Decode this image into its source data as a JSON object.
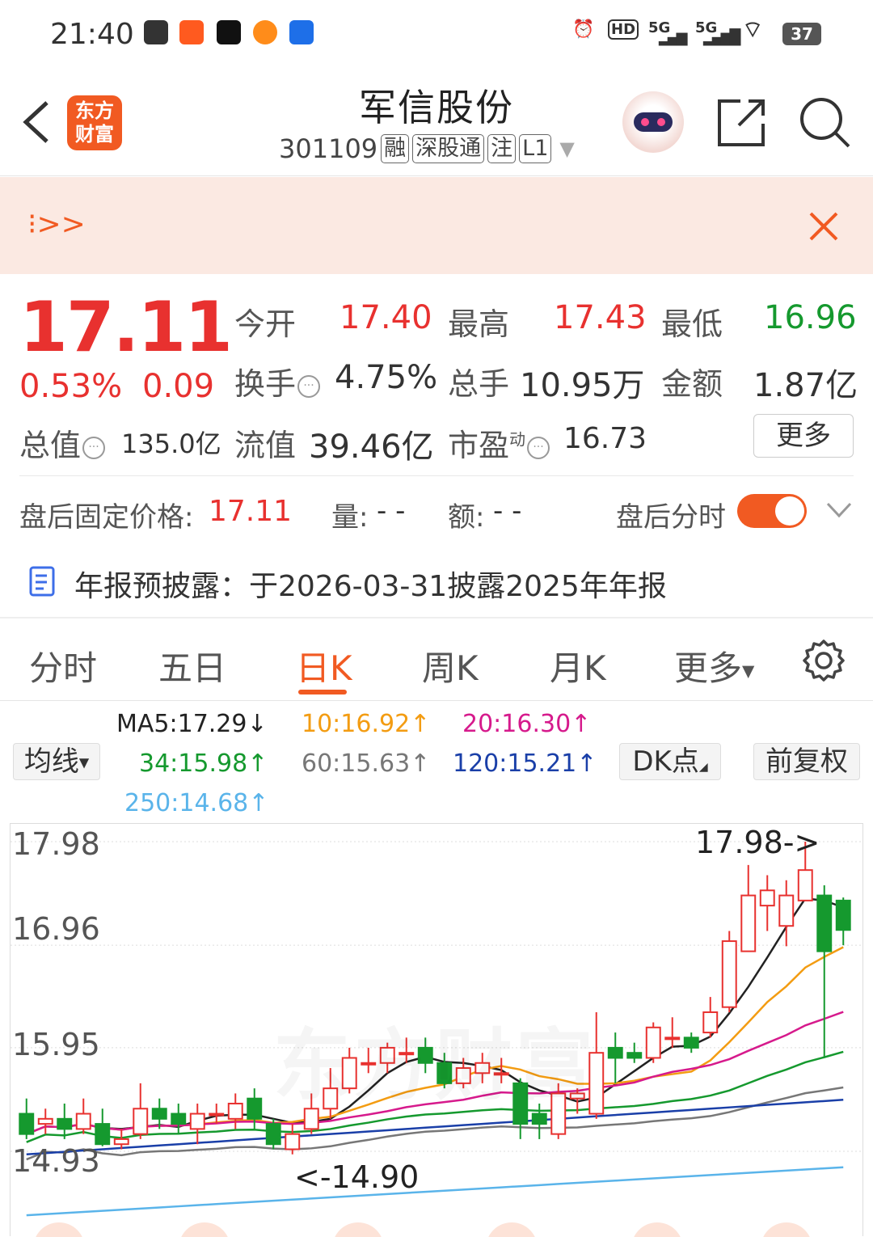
{
  "status": {
    "time": "21:40",
    "hd": "HD",
    "net1": "5G",
    "net2": "5G",
    "battery": "37"
  },
  "header": {
    "title": "军信股份",
    "code": "301109",
    "tags": [
      "融",
      "深股通",
      "注",
      "L1"
    ],
    "logo_line1": "东方",
    "logo_line2": "财富"
  },
  "banner": {
    "marquee": "⁝>>"
  },
  "quote": {
    "price": "17.11",
    "change_pct": "0.53%",
    "change": "0.09",
    "open_label": "今开",
    "open": "17.40",
    "high_label": "最高",
    "high": "17.43",
    "low_label": "最低",
    "low": "16.96",
    "turnover_label": "换手",
    "turnover": "4.75%",
    "volume_label": "总手",
    "volume": "10.95万",
    "amount_label": "金额",
    "amount": "1.87亿",
    "mktcap_label": "总值",
    "mktcap": "135.0亿",
    "float_label": "流值",
    "float": "39.46亿",
    "pe_label": "市盈",
    "pe_super": "动",
    "pe": "16.73",
    "more": "更多"
  },
  "afterhours": {
    "label": "盘后固定价格:",
    "price": "17.11",
    "vol_label": "量:",
    "vol": "- -",
    "amt_label": "额:",
    "amt": "- -",
    "toggle_label": "盘后分时"
  },
  "notice": "年报预披露：于2026-03-31披露2025年年报",
  "tabs": [
    "分时",
    "五日",
    "日K",
    "周K",
    "月K",
    "更多"
  ],
  "ma": {
    "selector": "均线",
    "ma5": "MA5:17.29↓",
    "ma10": "10:16.92↑",
    "ma20": "20:16.30↑",
    "ma34": "34:15.98↑",
    "ma60": "60:15.63↑",
    "ma120": "120:15.21↑",
    "ma250": "250:14.68↑",
    "dk": "DK点",
    "adjust": "前复权"
  },
  "colors": {
    "up": "#e8312f",
    "down": "#15992e",
    "accent": "#f15a22",
    "ma5": "#222222",
    "ma10": "#f39c12",
    "ma20": "#d61a8c",
    "ma34": "#15992e",
    "ma60": "#777777",
    "ma120": "#1a3fa8",
    "ma250": "#5ab4ea"
  },
  "chart_data": {
    "type": "candlestick",
    "y_ticks": [
      "17.98",
      "16.96",
      "15.95",
      "14.93"
    ],
    "max_label": "17.98->",
    "min_label": "<-14.90",
    "watermark": "东方财富",
    "candles": [
      {
        "o": 15.3,
        "c": 15.1,
        "h": 15.45,
        "l": 15.05
      },
      {
        "o": 15.2,
        "c": 15.25,
        "h": 15.35,
        "l": 15.1
      },
      {
        "o": 15.25,
        "c": 15.15,
        "h": 15.4,
        "l": 15.05
      },
      {
        "o": 15.15,
        "c": 15.3,
        "h": 15.45,
        "l": 15.1
      },
      {
        "o": 15.2,
        "c": 15.0,
        "h": 15.35,
        "l": 14.98
      },
      {
        "o": 15.0,
        "c": 15.05,
        "h": 15.15,
        "l": 14.95
      },
      {
        "o": 15.1,
        "c": 15.35,
        "h": 15.6,
        "l": 15.05
      },
      {
        "o": 15.35,
        "c": 15.25,
        "h": 15.45,
        "l": 15.15
      },
      {
        "o": 15.3,
        "c": 15.2,
        "h": 15.4,
        "l": 15.1
      },
      {
        "o": 15.15,
        "c": 15.3,
        "h": 15.4,
        "l": 15.0
      },
      {
        "o": 15.3,
        "c": 15.3,
        "h": 15.4,
        "l": 15.2
      },
      {
        "o": 15.25,
        "c": 15.4,
        "h": 15.5,
        "l": 15.15
      },
      {
        "o": 15.45,
        "c": 15.25,
        "h": 15.55,
        "l": 15.15
      },
      {
        "o": 15.2,
        "c": 15.0,
        "h": 15.25,
        "l": 14.95
      },
      {
        "o": 14.95,
        "c": 15.1,
        "h": 15.2,
        "l": 14.9
      },
      {
        "o": 15.15,
        "c": 15.35,
        "h": 15.5,
        "l": 15.1
      },
      {
        "o": 15.35,
        "c": 15.55,
        "h": 15.75,
        "l": 15.25
      },
      {
        "o": 15.55,
        "c": 15.85,
        "h": 15.95,
        "l": 15.5
      },
      {
        "o": 15.8,
        "c": 15.8,
        "h": 15.95,
        "l": 15.7
      },
      {
        "o": 15.8,
        "c": 15.95,
        "h": 16.0,
        "l": 15.7
      },
      {
        "o": 15.9,
        "c": 15.9,
        "h": 16.05,
        "l": 15.8
      },
      {
        "o": 15.95,
        "c": 15.8,
        "h": 16.05,
        "l": 15.7
      },
      {
        "o": 15.8,
        "c": 15.6,
        "h": 15.9,
        "l": 15.55
      },
      {
        "o": 15.6,
        "c": 15.75,
        "h": 15.85,
        "l": 15.55
      },
      {
        "o": 15.7,
        "c": 15.8,
        "h": 15.9,
        "l": 15.6
      },
      {
        "o": 15.7,
        "c": 15.7,
        "h": 15.85,
        "l": 15.6
      },
      {
        "o": 15.6,
        "c": 15.2,
        "h": 15.65,
        "l": 15.05
      },
      {
        "o": 15.3,
        "c": 15.2,
        "h": 15.4,
        "l": 15.05
      },
      {
        "o": 15.1,
        "c": 15.5,
        "h": 15.6,
        "l": 15.05
      },
      {
        "o": 15.45,
        "c": 15.5,
        "h": 15.55,
        "l": 15.3
      },
      {
        "o": 15.3,
        "c": 15.9,
        "h": 16.3,
        "l": 15.25
      },
      {
        "o": 15.95,
        "c": 15.85,
        "h": 16.1,
        "l": 15.6
      },
      {
        "o": 15.9,
        "c": 15.85,
        "h": 16.0,
        "l": 15.8
      },
      {
        "o": 15.85,
        "c": 16.15,
        "h": 16.2,
        "l": 15.8
      },
      {
        "o": 16.05,
        "c": 16.05,
        "h": 16.25,
        "l": 15.95
      },
      {
        "o": 16.05,
        "c": 15.95,
        "h": 16.1,
        "l": 15.9
      },
      {
        "o": 16.1,
        "c": 16.3,
        "h": 16.45,
        "l": 16.05
      },
      {
        "o": 16.35,
        "c": 17.0,
        "h": 17.1,
        "l": 16.3
      },
      {
        "o": 16.9,
        "c": 17.45,
        "h": 17.75,
        "l": 16.9
      },
      {
        "o": 17.35,
        "c": 17.5,
        "h": 17.65,
        "l": 17.1
      },
      {
        "o": 17.15,
        "c": 17.45,
        "h": 17.6,
        "l": 16.95
      },
      {
        "o": 17.4,
        "c": 17.7,
        "h": 17.98,
        "l": 17.4
      },
      {
        "o": 17.45,
        "c": 16.9,
        "h": 17.55,
        "l": 15.85
      },
      {
        "o": 17.4,
        "c": 17.11,
        "h": 17.43,
        "l": 16.96
      }
    ]
  }
}
